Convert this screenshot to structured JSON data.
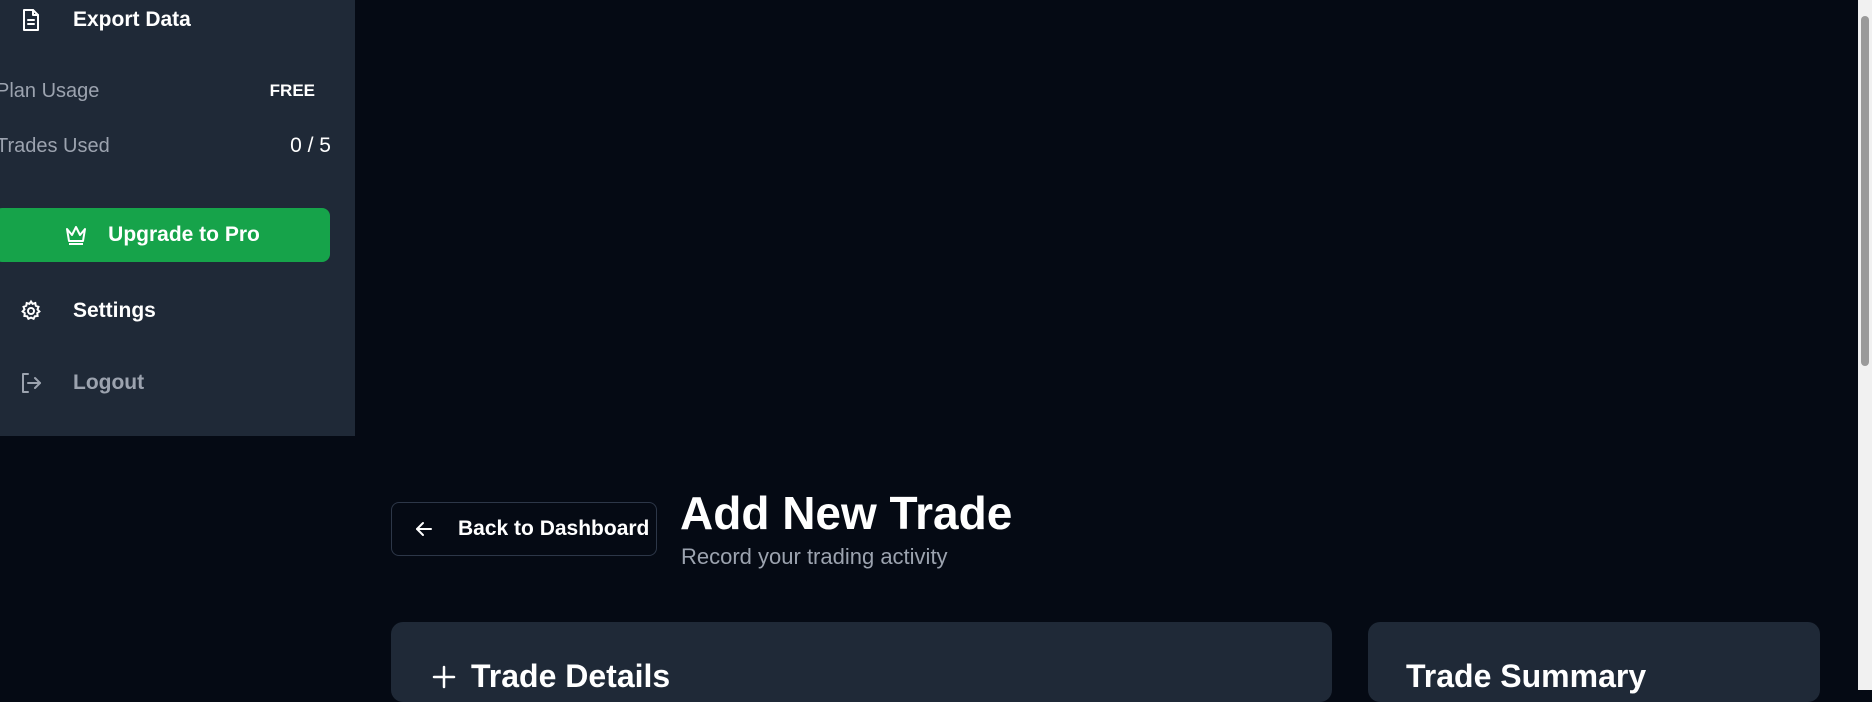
{
  "sidebar": {
    "export_data": {
      "label": "Export Data",
      "icon": "document-icon"
    },
    "plan_usage": {
      "label": "Plan Usage",
      "badge": "FREE"
    },
    "trades_used": {
      "label": "Trades Used",
      "value": "0 / 5"
    },
    "upgrade": {
      "label": "Upgrade to Pro",
      "icon": "crown-icon",
      "color": "#16a34a"
    },
    "settings": {
      "label": "Settings",
      "icon": "gear-icon"
    },
    "logout": {
      "label": "Logout",
      "icon": "logout-icon"
    }
  },
  "header": {
    "back_label": "Back to Dashboard",
    "title": "Add New Trade",
    "subtitle": "Record your trading activity"
  },
  "cards": {
    "details_title": "Trade Details",
    "summary_title": "Trade Summary"
  },
  "colors": {
    "background": "#050a14",
    "sidebar": "#1f2937",
    "accent": "#16a34a",
    "muted_text": "#9ca3af"
  }
}
